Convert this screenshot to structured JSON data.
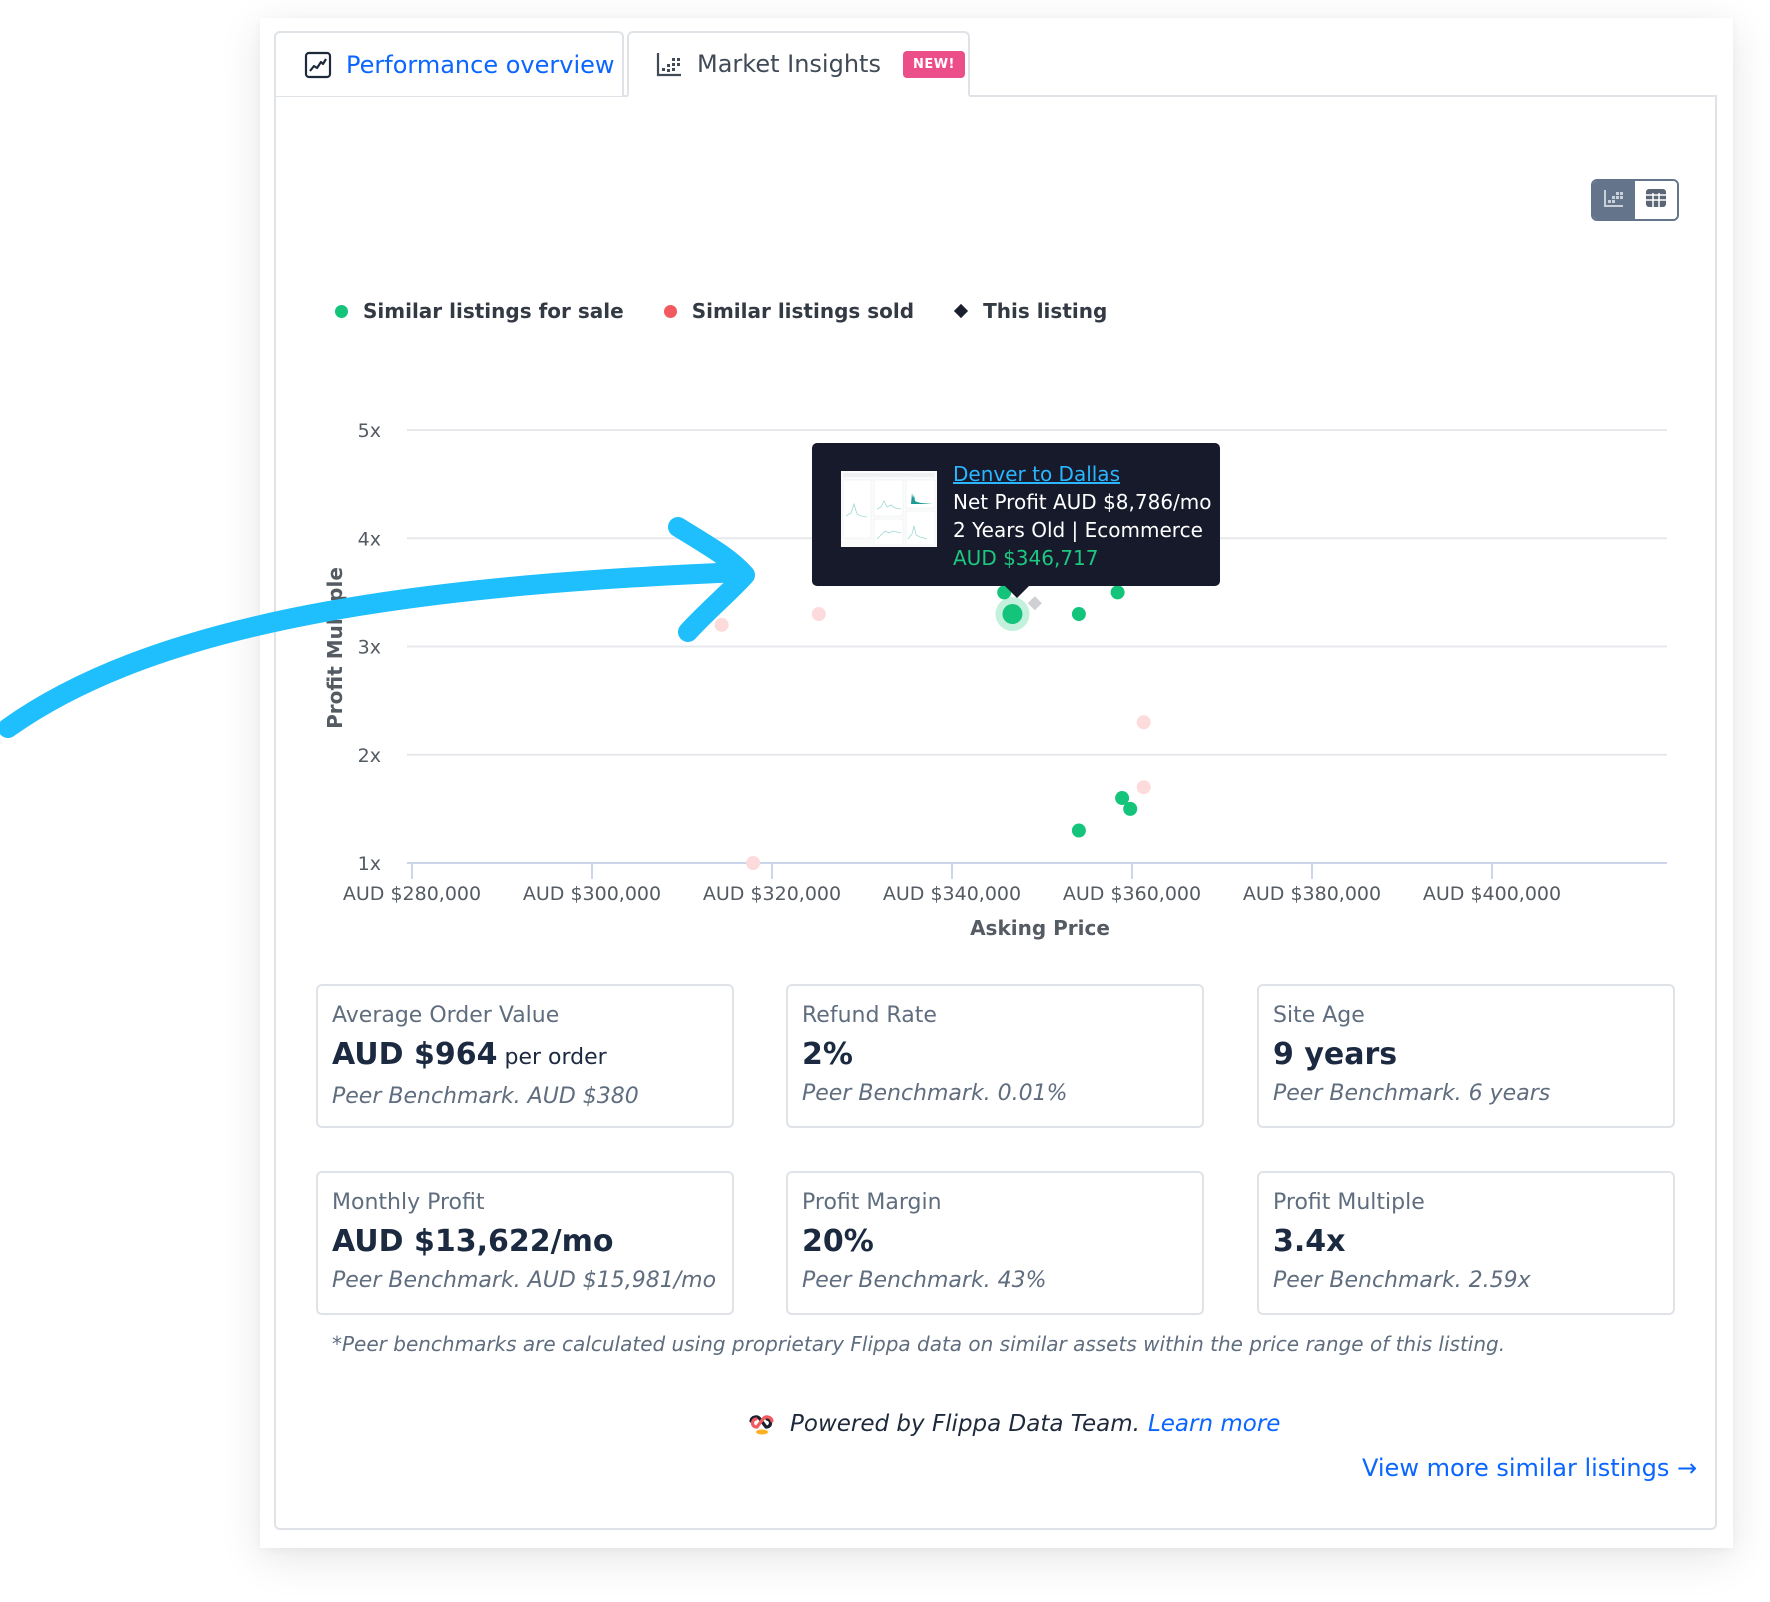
{
  "tabs": [
    {
      "label": "Performance overview",
      "icon": "line-chart-icon",
      "active": false
    },
    {
      "label": "Market Insights",
      "icon": "scatter-chart-icon",
      "active": true,
      "badge": "NEW!"
    }
  ],
  "view_toggle": {
    "options": [
      "chart-view",
      "table-view"
    ],
    "selected": "chart-view"
  },
  "legend": [
    {
      "label": "Similar listings for sale",
      "color": "#14c47a",
      "shape": "circle"
    },
    {
      "label": "Similar listings sold",
      "color": "#f25a5f",
      "shape": "circle"
    },
    {
      "label": "This listing",
      "color": "#1a1f2e",
      "shape": "diamond"
    }
  ],
  "tooltip": {
    "title": "Denver to Dallas",
    "net_profit": "Net Profit AUD $8,786/mo",
    "details": "2 Years Old | Ecommerce",
    "price": "AUD $346,717"
  },
  "chart_data": {
    "type": "scatter",
    "xlabel": "Asking Price",
    "ylabel": "Profit Multiple",
    "xlim": [
      278000,
      412000
    ],
    "ylim": [
      1,
      5
    ],
    "grid": true,
    "legend_position": "top-left",
    "x_ticks": [
      280000,
      300000,
      320000,
      340000,
      360000,
      380000,
      400000
    ],
    "x_tick_labels": [
      "AUD $280,000",
      "AUD $300,000",
      "AUD $320,000",
      "AUD $340,000",
      "AUD $360,000",
      "AUD $380,000",
      "AUD $400,000"
    ],
    "y_ticks": [
      1,
      2,
      3,
      4,
      5
    ],
    "y_tick_labels": [
      "1x",
      "2x",
      "3x",
      "4x",
      "5x"
    ],
    "series": [
      {
        "name": "Similar listings for sale",
        "color": "#14c47a",
        "points": [
          {
            "x": 345800,
            "y": 3.5
          },
          {
            "x": 346717,
            "y": 3.3,
            "highlighted": true
          },
          {
            "x": 354100,
            "y": 3.3
          },
          {
            "x": 358400,
            "y": 3.5
          },
          {
            "x": 358900,
            "y": 1.6
          },
          {
            "x": 359800,
            "y": 1.5
          },
          {
            "x": 354100,
            "y": 1.3
          }
        ]
      },
      {
        "name": "Similar listings sold",
        "color": "#fddadb",
        "points": [
          {
            "x": 314400,
            "y": 3.2
          },
          {
            "x": 325200,
            "y": 3.3
          },
          {
            "x": 317900,
            "y": 1.0
          },
          {
            "x": 361300,
            "y": 2.3
          },
          {
            "x": 361300,
            "y": 1.7
          }
        ]
      },
      {
        "name": "This listing",
        "color": "#d0d0d4",
        "points": [
          {
            "x": 349200,
            "y": 3.4
          }
        ]
      }
    ]
  },
  "stats": [
    {
      "label": "Average Order Value",
      "value": "AUD $964",
      "unit": " per order",
      "benchmark": "Peer Benchmark. AUD $380"
    },
    {
      "label": "Refund Rate",
      "value": "2%",
      "unit": "",
      "benchmark": "Peer Benchmark. 0.01%"
    },
    {
      "label": "Site Age",
      "value": "9 years",
      "unit": "",
      "benchmark": "Peer Benchmark. 6 years"
    },
    {
      "label": "Monthly Profit",
      "value": "AUD $13,622/mo",
      "unit": "",
      "benchmark": "Peer Benchmark. AUD $15,981/mo"
    },
    {
      "label": "Profit Margin",
      "value": "20%",
      "unit": "",
      "benchmark": "Peer Benchmark. 43%"
    },
    {
      "label": "Profit Multiple",
      "value": "3.4x",
      "unit": "",
      "benchmark": "Peer Benchmark. 2.59x"
    }
  ],
  "footnote": "*Peer benchmarks are calculated using proprietary Flippa data on similar assets within the price range of this listing.",
  "powered_by": {
    "text": "Powered by Flippa Data Team.",
    "link": "Learn more"
  },
  "view_more": "View more similar listings →",
  "annotation": {
    "type": "arrow",
    "color": "#1fbefc"
  }
}
